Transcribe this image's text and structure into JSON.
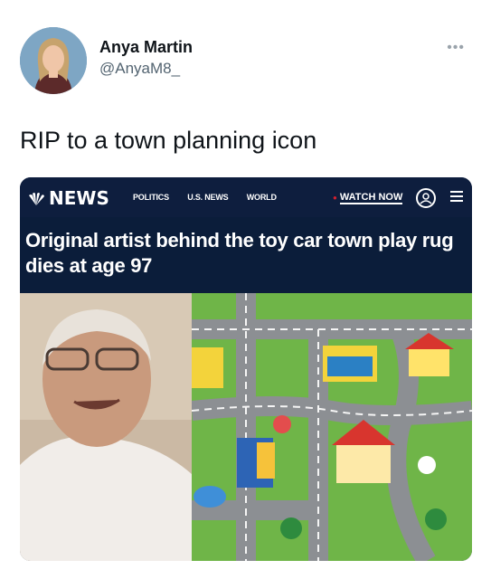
{
  "author": {
    "name": "Anya Martin",
    "handle": "@AnyaM8_",
    "more_icon": "more-horizontal-icon"
  },
  "tweet": {
    "text": "RIP to a town planning icon"
  },
  "media": {
    "logo_text": "NEWS",
    "nav": [
      "POLITICS",
      "U.S. NEWS",
      "WORLD"
    ],
    "watch_now": "WATCH NOW",
    "headline": "Original artist behind the toy car town play rug dies at age 97",
    "colors": {
      "navy": "#0e1e3e",
      "accent": "#d3202f"
    }
  }
}
